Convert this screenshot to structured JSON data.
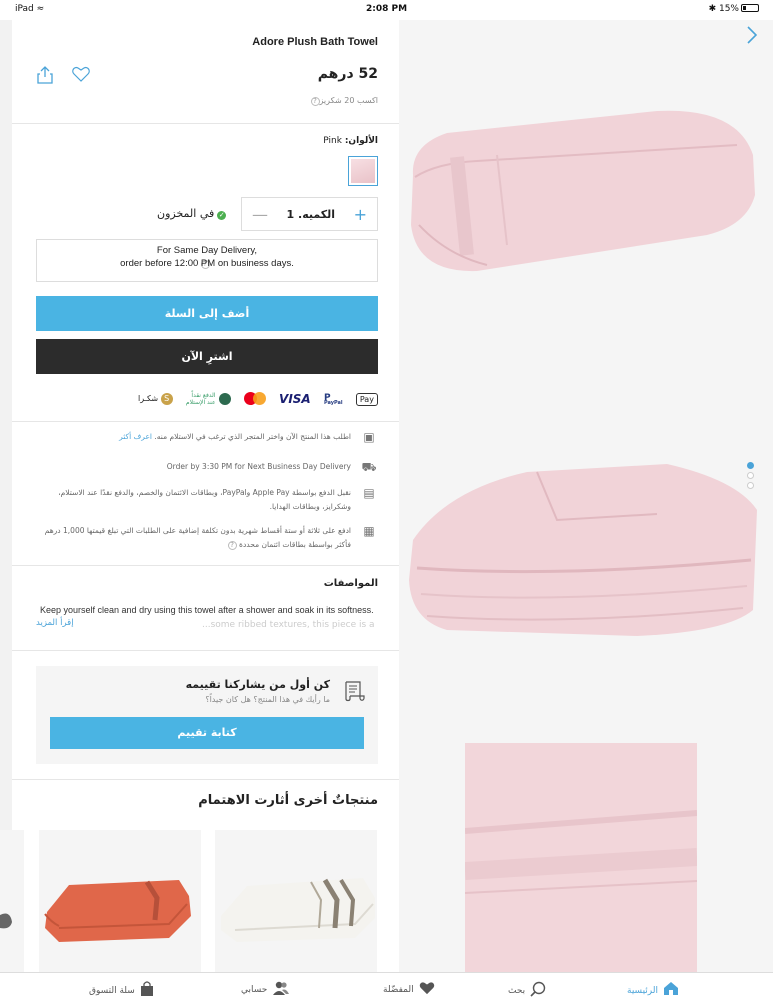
{
  "status_bar": {
    "device": "iPad",
    "time": "2:08 PM",
    "battery": "15%"
  },
  "product": {
    "title": "Adore Plush Bath Towel",
    "price": "52 درهم",
    "points": "اكسب 20 شكريز",
    "colors_label": "الألوان:",
    "color_value": "Pink",
    "quantity_label": "الكميه.",
    "quantity_value": "1",
    "stock": "في المخزون",
    "delivery_line1": "For Same Day Delivery,",
    "delivery_line2": "order before 12:00 PM on business days.",
    "add_to_cart": "أضف إلى السلة",
    "buy_now": "اشترِ الآن"
  },
  "payments": {
    "apple_pay": "Pay",
    "paypal": "PayPal",
    "visa": "VISA",
    "cod_line1": "الدفع نقداً",
    "cod_line2": "عند الإستلام",
    "shukri": "شكـرا"
  },
  "info": {
    "pickup_text": "اطلب هذا المنتج الآن واختر المتجر الذي ترغب في الاستلام منه.",
    "pickup_link": "اعرف أكثر",
    "next_day": "Order by 3:30 PM for Next Business Day Delivery",
    "payment_methods": "نقبل الدفع بواسطة Apple Pay وPayPal، وبطاقات الائتمان والخصم، والدفع نقدًا عند الاستلام، وشكرايز، وبطاقات الهدايا.",
    "installments": "ادفع على ثلاثة أو ستة أقساط شهرية بدون تكلفة إضافية على الطلبات التي تبلغ قيمتها 1,000 درهم فأكثر بواسطة بطاقات ائتمان محددة"
  },
  "specs": {
    "title": "المواصفات",
    "text": "Keep yourself clean and dry using this towel after a shower and soak in its softness.",
    "text_faded": "...some ribbed textures, this piece is a",
    "read_more": "إقرأ المزيد"
  },
  "review": {
    "title": "كن أول من يشاركنا تقييمه",
    "subtitle": "ما رأيك في هذا المنتج؟ هل كان جيداً؟",
    "button": "كتابة تقييم"
  },
  "related": {
    "title": "منتجاتٌ أخرى أثارت الاهتمام"
  },
  "bottom_nav": [
    {
      "label": "الرئيسية",
      "icon": "home-icon"
    },
    {
      "label": "بحث",
      "icon": "search-icon"
    },
    {
      "label": "المفضّلة",
      "icon": "heart-icon"
    },
    {
      "label": "حسابي",
      "icon": "account-icon"
    },
    {
      "label": "سلة التسوق",
      "icon": "bag-icon"
    }
  ],
  "colors": {
    "accent": "#4ab4e3",
    "buy_button": "#2c2c2c",
    "towel_pink": "#f1d3d8",
    "in_stock": "#4caf50"
  }
}
